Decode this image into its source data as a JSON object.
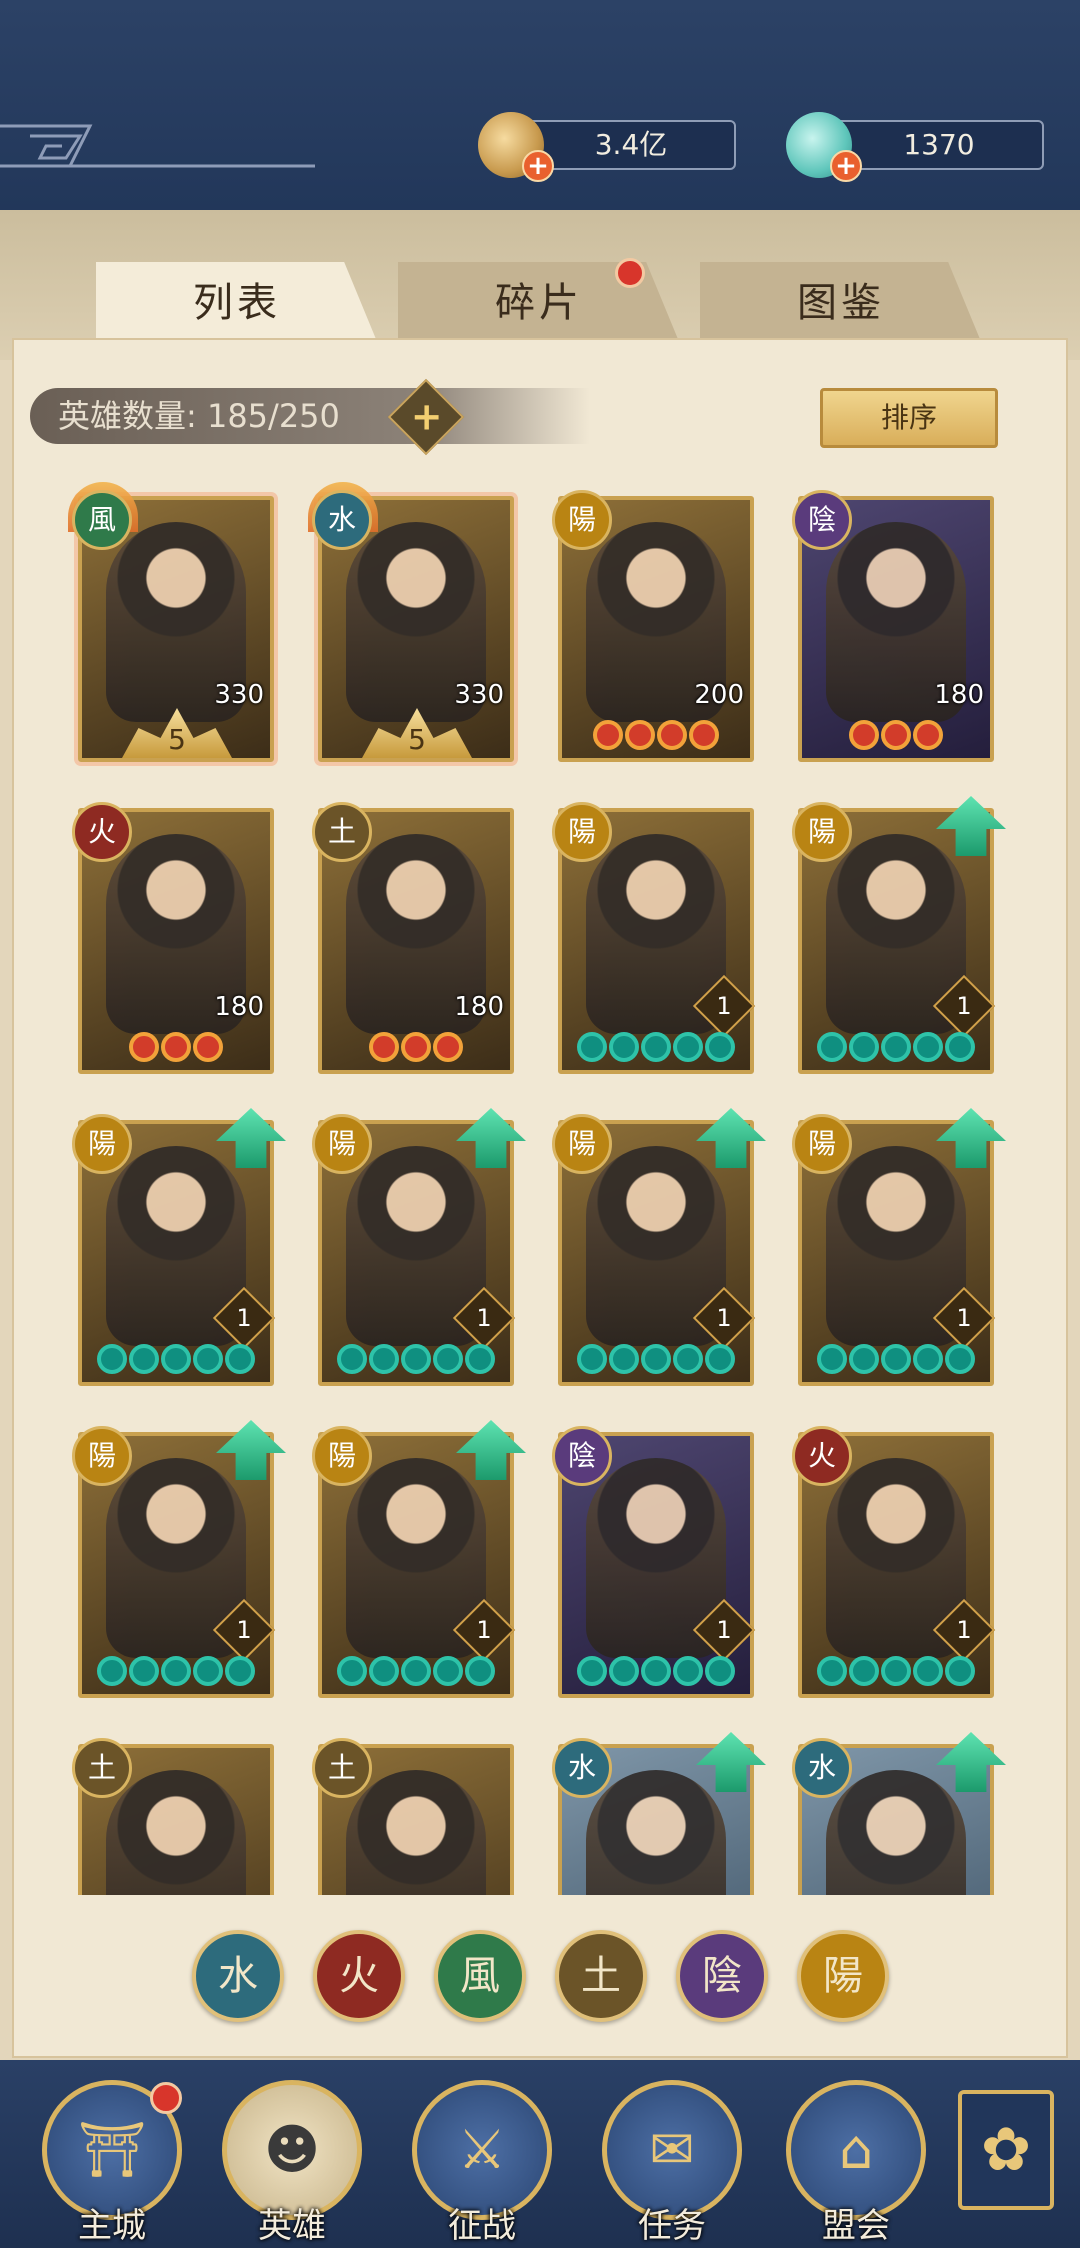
{
  "currency": {
    "gold": {
      "value": "3.4亿",
      "icon": "coin-icon"
    },
    "jade": {
      "value": "1370",
      "icon": "jade-icon"
    }
  },
  "tabs": [
    {
      "label": "列表",
      "active": true
    },
    {
      "label": "碎片",
      "has_dot": true
    },
    {
      "label": "图鉴"
    }
  ],
  "hero_count": "英雄数量: 185/250",
  "sort_label": "排序",
  "cards": [
    {
      "element": "風",
      "level": "330",
      "stars": "5",
      "style": "special"
    },
    {
      "element": "水",
      "level": "330",
      "stars": "5",
      "style": "special"
    },
    {
      "element": "陽",
      "level": "200",
      "red_stars": 4
    },
    {
      "element": "陰",
      "level": "180",
      "red_stars": 3
    },
    {
      "element": "火",
      "level": "180",
      "red_stars": 3
    },
    {
      "element": "土",
      "level": "180",
      "red_stars": 3
    },
    {
      "element": "陽",
      "rank": "1",
      "teal_stars": 5
    },
    {
      "element": "陽",
      "rank": "1",
      "teal_stars": 5,
      "upgrade": true
    },
    {
      "element": "陽",
      "rank": "1",
      "teal_stars": 5,
      "upgrade": true
    },
    {
      "element": "陽",
      "rank": "1",
      "teal_stars": 5,
      "upgrade": true
    },
    {
      "element": "陽",
      "rank": "1",
      "teal_stars": 5,
      "upgrade": true
    },
    {
      "element": "陽",
      "rank": "1",
      "teal_stars": 5,
      "upgrade": true
    },
    {
      "element": "陽",
      "rank": "1",
      "teal_stars": 5,
      "upgrade": true
    },
    {
      "element": "陽",
      "rank": "1",
      "teal_stars": 5,
      "upgrade": true
    },
    {
      "element": "陰",
      "rank": "1",
      "teal_stars": 5
    },
    {
      "element": "火",
      "rank": "1",
      "teal_stars": 5
    },
    {
      "element": "土"
    },
    {
      "element": "土"
    },
    {
      "element": "水",
      "upgrade": true
    },
    {
      "element": "水",
      "upgrade": true
    }
  ],
  "filters": [
    "水",
    "火",
    "風",
    "土",
    "陰",
    "陽"
  ],
  "nav": [
    {
      "label": "主城",
      "glyph": "⛩",
      "has_dot": true
    },
    {
      "label": "英雄",
      "glyph": "☻"
    },
    {
      "label": "征战",
      "glyph": "⚔"
    },
    {
      "label": "任务",
      "glyph": "✉"
    },
    {
      "label": "盟会",
      "glyph": "⌂"
    }
  ],
  "menu_icon": "✿"
}
